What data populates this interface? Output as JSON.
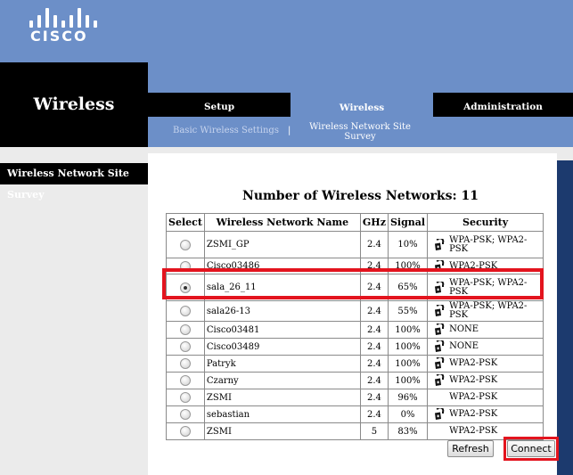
{
  "brand": {
    "logo_text": "CISCO",
    "logo_icon": "cisco-bars-icon"
  },
  "section": {
    "title": "Wireless"
  },
  "tabs": [
    {
      "label": "Setup",
      "active": false
    },
    {
      "label": "Wireless",
      "active": true
    },
    {
      "label": "Administration",
      "active": false
    }
  ],
  "subnav": {
    "basic_label": "Basic Wireless Settings",
    "separator": "|",
    "survey_label": "Wireless Network Site Survey"
  },
  "sidebar": {
    "page_label": "Wireless Network Site Survey"
  },
  "survey": {
    "title": "Number of Wireless Networks: 11",
    "columns": [
      "Select",
      "Wireless Network Name",
      "GHz",
      "Signal",
      "Security"
    ],
    "rows": [
      {
        "selected": false,
        "name": "ZSMI_GP",
        "ghz": "2.4",
        "signal": "10%",
        "lock": true,
        "security": "WPA-PSK; WPA2-PSK"
      },
      {
        "selected": false,
        "name": "Cisco03486",
        "ghz": "2.4",
        "signal": "100%",
        "lock": true,
        "security": "WPA2-PSK"
      },
      {
        "selected": true,
        "name": "sala_26_11",
        "ghz": "2.4",
        "signal": "65%",
        "lock": true,
        "security": "WPA-PSK; WPA2-PSK"
      },
      {
        "selected": false,
        "name": "sala26-13",
        "ghz": "2.4",
        "signal": "55%",
        "lock": true,
        "security": "WPA-PSK; WPA2-PSK"
      },
      {
        "selected": false,
        "name": "Cisco03481",
        "ghz": "2.4",
        "signal": "100%",
        "lock": true,
        "security": "NONE"
      },
      {
        "selected": false,
        "name": "Cisco03489",
        "ghz": "2.4",
        "signal": "100%",
        "lock": true,
        "security": "NONE"
      },
      {
        "selected": false,
        "name": "Patryk",
        "ghz": "2.4",
        "signal": "100%",
        "lock": true,
        "security": "WPA2-PSK"
      },
      {
        "selected": false,
        "name": "Czarny",
        "ghz": "2.4",
        "signal": "100%",
        "lock": true,
        "security": "WPA2-PSK"
      },
      {
        "selected": false,
        "name": "ZSMI",
        "ghz": "2.4",
        "signal": "96%",
        "lock": false,
        "security": "WPA2-PSK"
      },
      {
        "selected": false,
        "name": "sebastian",
        "ghz": "2.4",
        "signal": "0%",
        "lock": true,
        "security": "WPA2-PSK"
      },
      {
        "selected": false,
        "name": "ZSMI",
        "ghz": "5",
        "signal": "83%",
        "lock": false,
        "security": "WPA2-PSK"
      }
    ]
  },
  "buttons": {
    "refresh": "Refresh",
    "connect": "Connect"
  },
  "colors": {
    "header_blue": "#6c8fc8",
    "highlight_red": "#e3141e",
    "dark_navy": "#1c3a6e"
  }
}
